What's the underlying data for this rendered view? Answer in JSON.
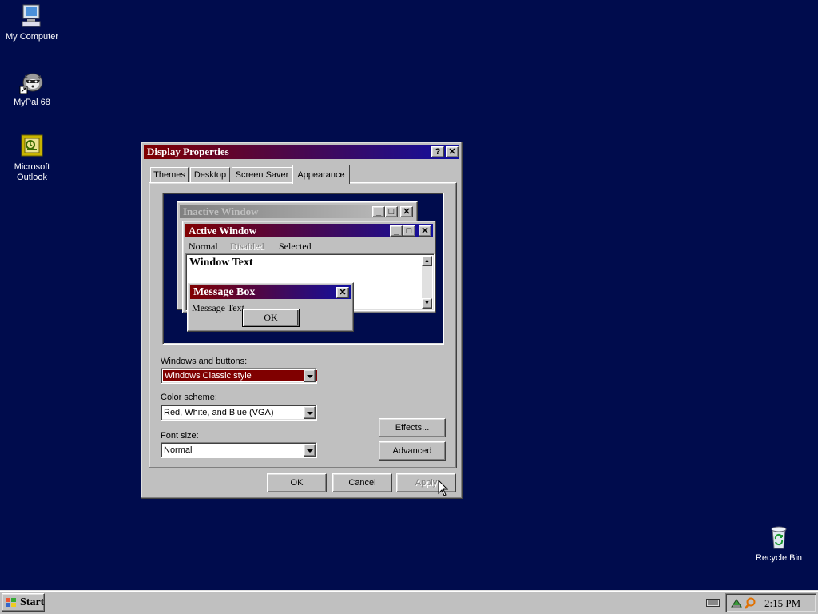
{
  "desktop": {
    "icons": [
      {
        "label": "My Computer"
      },
      {
        "label": "MyPal 68"
      },
      {
        "label_line1": "Microsoft",
        "label_line2": "Outlook"
      },
      {
        "label": "Recycle Bin"
      }
    ]
  },
  "dialog": {
    "title": "Display Properties",
    "tabs": [
      "Themes",
      "Desktop",
      "Screen Saver",
      "Appearance"
    ],
    "preview": {
      "inactive_title": "Inactive Window",
      "active_title": "Active Window",
      "menu": [
        "Normal",
        "Disabled",
        "Selected"
      ],
      "window_text": "Window Text",
      "msgbox_title": "Message Box",
      "msgbox_text": "Message Text",
      "msgbox_ok": "OK"
    },
    "windows_buttons_label": "Windows and buttons:",
    "windows_buttons_value": "Windows Classic style",
    "color_scheme_label": "Color scheme:",
    "color_scheme_value": "Red, White, and Blue (VGA)",
    "font_size_label": "Font size:",
    "font_size_value": "Normal",
    "effects_button": "Effects...",
    "advanced_button": "Advanced",
    "ok_button": "OK",
    "cancel_button": "Cancel",
    "apply_button": "Apply"
  },
  "taskbar": {
    "start_label": "Start",
    "clock": "2:15 PM"
  },
  "colors": {
    "desktop": "#000c4d",
    "title_start": "#800000",
    "title_end": "#1010a0",
    "selection": "#800000"
  }
}
